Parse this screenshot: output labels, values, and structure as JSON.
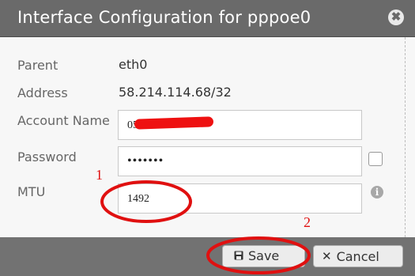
{
  "dialog": {
    "title": "Interface Configuration for pppoe0",
    "close_glyph": "✖"
  },
  "fields": {
    "parent_label": "Parent",
    "parent_value": "eth0",
    "address_label": "Address",
    "address_value": "58.214.114.68/32",
    "account_label": "Account Name",
    "account_value": "05",
    "password_label": "Password",
    "password_value": "•••••••",
    "mtu_label": "MTU",
    "mtu_value": "1492",
    "info_glyph": "i"
  },
  "buttons": {
    "save_label": "Save",
    "cancel_label": "Cancel",
    "save_icon": "floppy-disk-icon",
    "cancel_icon": "x-icon"
  },
  "annotations": {
    "marker_1": "1",
    "marker_2": "2",
    "color": "#e01010"
  }
}
